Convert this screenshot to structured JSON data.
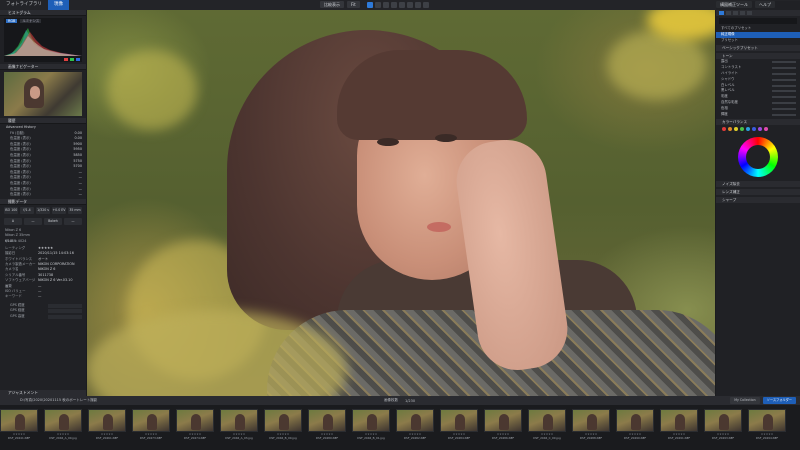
{
  "topbar": {
    "tab_library": "フォトライブラリ",
    "tab_edit": "現像",
    "center_pill_1": "比較表示",
    "center_pill_2": "Fit",
    "right_pill_1": "構図補正ツール",
    "right_pill_2": "ヘルプ"
  },
  "left_panel": {
    "histogram_title": "ヒストグラム",
    "histogram_mode": "RGB",
    "histogram_mode2": "ルミナンス",
    "navigator_title": "画像ナビゲーター",
    "history_title": "履歴",
    "history_group": "Advanced History",
    "history": [
      {
        "k": "Fit (自動)",
        "v": "0.00"
      },
      {
        "k": "色温度 (表示)",
        "v": "0.00"
      },
      {
        "k": "色温度 (表示)",
        "v": "5900"
      },
      {
        "k": "色温度 (表示)",
        "v": "5950"
      },
      {
        "k": "色温度 (表示)",
        "v": "5850"
      },
      {
        "k": "色温度 (表示)",
        "v": "5750"
      },
      {
        "k": "色温度 (表示)",
        "v": "5700"
      },
      {
        "k": "色温度 (表示)",
        "v": "—"
      },
      {
        "k": "色温度 (表示)",
        "v": "—"
      },
      {
        "k": "色温度 (表示)",
        "v": "—"
      },
      {
        "k": "色温度 (表示)",
        "v": "—"
      },
      {
        "k": "色温度 (表示)",
        "v": "—"
      }
    ],
    "shooting_title": "撮影データ",
    "exif_buttons": [
      "ISO 100",
      "f/1.4",
      "1/320 s",
      "+0.0 EV",
      "35 mm"
    ],
    "mode_buttons": [
      "A",
      "—",
      "Bokeh",
      "—"
    ],
    "camera": "Nikon Z 6",
    "camera_lens": "Nikon Z 35mm f/1.8 S",
    "resolution": "6048 x 4024",
    "meta": [
      {
        "k": "レーティング",
        "v": "★★★★★"
      },
      {
        "k": "撮影日",
        "v": "2020/11/15 14:03:16"
      },
      {
        "k": "ホワイトバランス",
        "v": "オート"
      },
      {
        "k": "カメラ製造メーカー",
        "v": "NIKON CORPORATION"
      },
      {
        "k": "カメラ名",
        "v": "NIKON Z 6"
      },
      {
        "k": "シリアル番号",
        "v": "3011738"
      },
      {
        "k": "ソフトウェアバージョン",
        "v": "NIKON Z 6 Ver.03.10"
      },
      {
        "k": "画質",
        "v": "—"
      },
      {
        "k": "ISO バリュー",
        "v": "—"
      },
      {
        "k": "キーワード",
        "v": "—"
      }
    ],
    "gps": [
      {
        "k": "GPS 緯度"
      },
      {
        "k": "GPS 経度"
      },
      {
        "k": "GPS 高度"
      }
    ],
    "adjust_title": "アジャストメント"
  },
  "right_panel": {
    "preset_item": "すべてのプリセット",
    "preset_highlight": "純正現像",
    "section_1": "ベーシックプリセット",
    "section_2": "トーン",
    "section_3": "カラーバランス",
    "item_a": "プリセット",
    "sliders": [
      "露出",
      "コントラスト",
      "ハイライト",
      "シャドウ",
      "白レベル",
      "黒レベル",
      "彩度",
      "自然な彩度",
      "色相",
      "輝度"
    ],
    "section_4": "ノイズ除去",
    "section_5": "レンズ補正",
    "section_6": "シャープ",
    "swatch_colors": [
      "#e03a3a",
      "#e08a2a",
      "#e0d02a",
      "#4ac04a",
      "#2aa0e0",
      "#3a5ae0",
      "#a04ae0",
      "#e04ab0"
    ]
  },
  "statusbar": {
    "path": "D:\\写真\\2020\\20201115 秋のポートレート撮影",
    "count_label": "画像枚数",
    "count": "1/230",
    "btn_1": "My Collection",
    "btn_2": "ソースフォルダー"
  },
  "filmstrip": [
    "DSF_20441.NEF",
    "DSF_2046_A_00.jpg",
    "DSF_20461.NEF",
    "DSF_20473.NEF",
    "DSF_20474.NEF",
    "DSF_2046_A_03.jpg",
    "DSF_2046_B_00.jpg",
    "DSF_20480.NEF",
    "DSF_2046_B_01.jpg",
    "DSF_20482.NEF",
    "DSF_20484.NEF",
    "DSF_20486.NEF",
    "DSF_2046_C_00.jpg",
    "DSF_20488.NEF",
    "DSF_20490.NEF",
    "DSF_20491.NEF",
    "DSF_20493.NEF",
    "DSF_20494.NEF"
  ]
}
